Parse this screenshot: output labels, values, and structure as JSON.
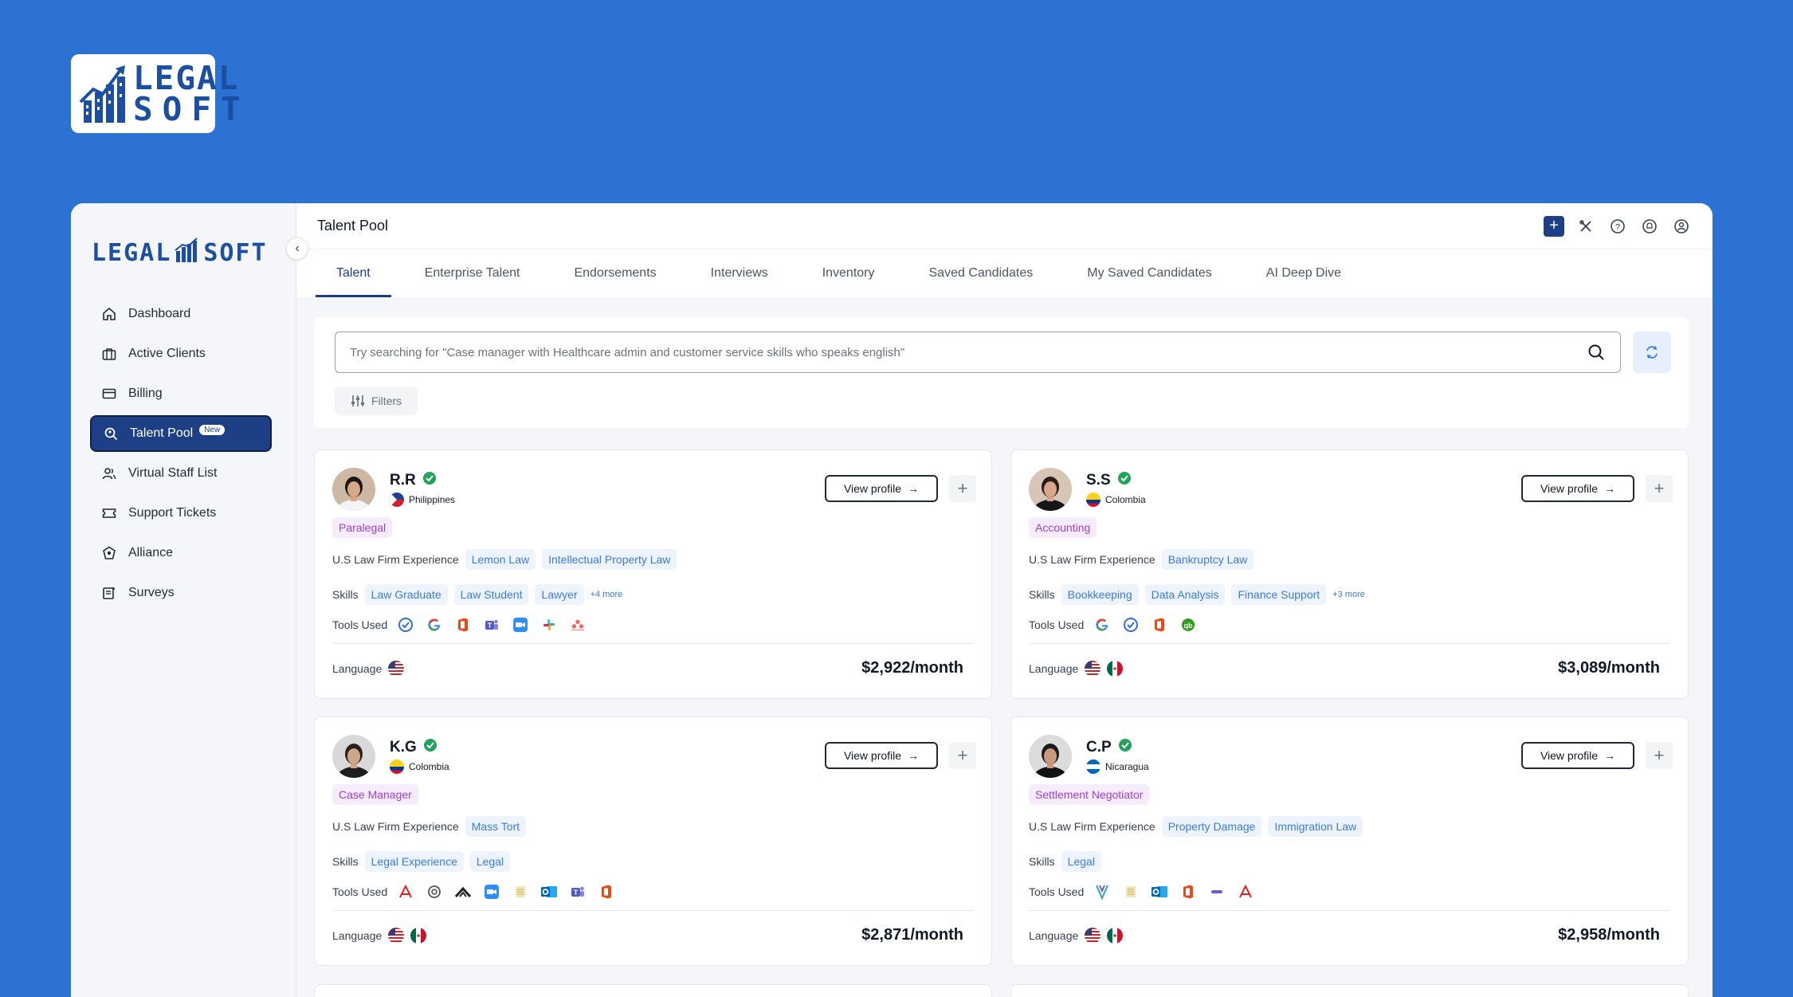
{
  "brand": {
    "logo_line1": "LEGAL",
    "logo_line2": "SOFT",
    "sidebar_logo_left": "LEGAL",
    "sidebar_logo_right": "SOFT"
  },
  "colors": {
    "background": "#2c72d2",
    "primary": "#1d3f86",
    "chip_text": "#3a7be0",
    "role_text": "#a03fd2",
    "verified": "#22a35a"
  },
  "sidebar": {
    "items": [
      {
        "label": "Dashboard",
        "icon": "home-icon"
      },
      {
        "label": "Active Clients",
        "icon": "briefcase-icon"
      },
      {
        "label": "Billing",
        "icon": "credit-card-icon"
      },
      {
        "label": "Talent Pool",
        "icon": "talent-search-icon",
        "badge": "New",
        "active": true
      },
      {
        "label": "Virtual Staff List",
        "icon": "users-icon"
      },
      {
        "label": "Support Tickets",
        "icon": "ticket-icon"
      },
      {
        "label": "Alliance",
        "icon": "alliance-icon"
      },
      {
        "label": "Surveys",
        "icon": "survey-icon"
      }
    ]
  },
  "header": {
    "title": "Talent Pool"
  },
  "tabs": [
    "Talent",
    "Enterprise Talent",
    "Endorsements",
    "Interviews",
    "Inventory",
    "Saved Candidates",
    "My Saved Candidates",
    "AI Deep Dive"
  ],
  "search": {
    "placeholder": "Try searching for \"Case manager with Healthcare admin and customer service skills who speaks english\"",
    "filters_label": "Filters"
  },
  "labels": {
    "experience": "U.S Law Firm Experience",
    "skills": "Skills",
    "tools": "Tools Used",
    "language": "Language",
    "view_profile": "View profile"
  },
  "cards": [
    {
      "name": "R.R",
      "country": "Philippines",
      "role": "Paralegal",
      "experience": [
        "Lemon Law",
        "Intellectual Property Law"
      ],
      "skills": [
        "Law Graduate",
        "Law Student",
        "Lawyer"
      ],
      "more": "+4 more",
      "tools": [
        "check-circle-tool-icon",
        "google-icon",
        "office-icon",
        "teams-icon",
        "zoom-icon",
        "slack-icon",
        "asana-icon"
      ],
      "languages": [
        "us-flag"
      ],
      "price": "$2,922/month"
    },
    {
      "name": "S.S",
      "country": "Colombia",
      "role": "Accounting",
      "experience": [
        "Bankruptcy Law"
      ],
      "skills": [
        "Bookkeeping",
        "Data Analysis",
        "Finance Support"
      ],
      "more": "+3 more",
      "tools": [
        "google-icon",
        "check-circle-tool-icon",
        "office-icon",
        "quickbooks-icon"
      ],
      "languages": [
        "us-flag",
        "mexico-flag"
      ],
      "price": "$3,089/month"
    },
    {
      "name": "K.G",
      "country": "Colombia",
      "role": "Case Manager",
      "experience": [
        "Mass Tort"
      ],
      "skills": [
        "Legal Experience",
        "Legal"
      ],
      "more": "",
      "tools": [
        "acrobat-icon",
        "chatgpt-icon",
        "arrow-tool-icon",
        "zoom-icon",
        "notes-icon",
        "outlook-icon",
        "teams-icon",
        "office-icon"
      ],
      "languages": [
        "us-flag",
        "mexico-flag"
      ],
      "price": "$2,871/month"
    },
    {
      "name": "C.P",
      "country": "Nicaragua",
      "role": "Settlement Negotiator",
      "experience": [
        "Property Damage",
        "Immigration Law"
      ],
      "skills": [
        "Legal"
      ],
      "more": "",
      "tools": [
        "filevine-icon",
        "notes-icon",
        "outlook-icon",
        "office-icon",
        "dash-tool-icon",
        "acrobat-icon"
      ],
      "languages": [
        "us-flag",
        "mexico-flag"
      ],
      "price": "$2,958/month"
    }
  ]
}
